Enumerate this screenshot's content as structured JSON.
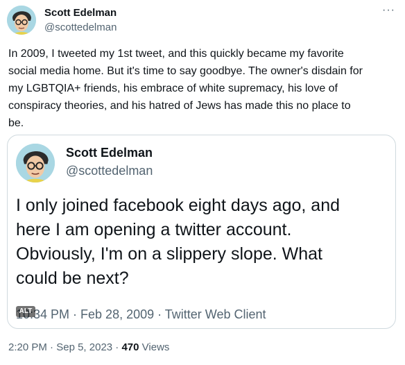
{
  "tweet": {
    "author_name": "Scott Edelman",
    "author_handle": "@scottedelman",
    "more_icon": "more-horizontal-icon",
    "more_glyph": "···",
    "text": "In 2009, I tweeted my 1st tweet, and this quickly became my favorite\nsocial media home. But it's time to say goodbye. The owner's disdain for\nmy LGBTQIA+ friends, his embrace of white supremacy, his love of\nconspiracy theories, and his hatred of Jews has made this no place to\nbe.",
    "time": "2:20 PM",
    "date": "Sep 5, 2023",
    "views_count": "470",
    "views_label": "Views",
    "separator": "·"
  },
  "quoted_tweet": {
    "author_name": "Scott Edelman",
    "author_handle": "@scottedelman",
    "text": "I only joined facebook eight days ago, and\nhere I am opening a twitter account.\nObviously, I'm on a slippery slope. What\ncould be next?",
    "meta": "10:34 PM · Feb 28, 2009 · Twitter Web Client",
    "alt_badge": "ALT"
  },
  "colors": {
    "text_primary": "#0f1419",
    "text_secondary": "#536471",
    "border": "#cfd9de",
    "avatar_background": "#a9d7e3"
  }
}
